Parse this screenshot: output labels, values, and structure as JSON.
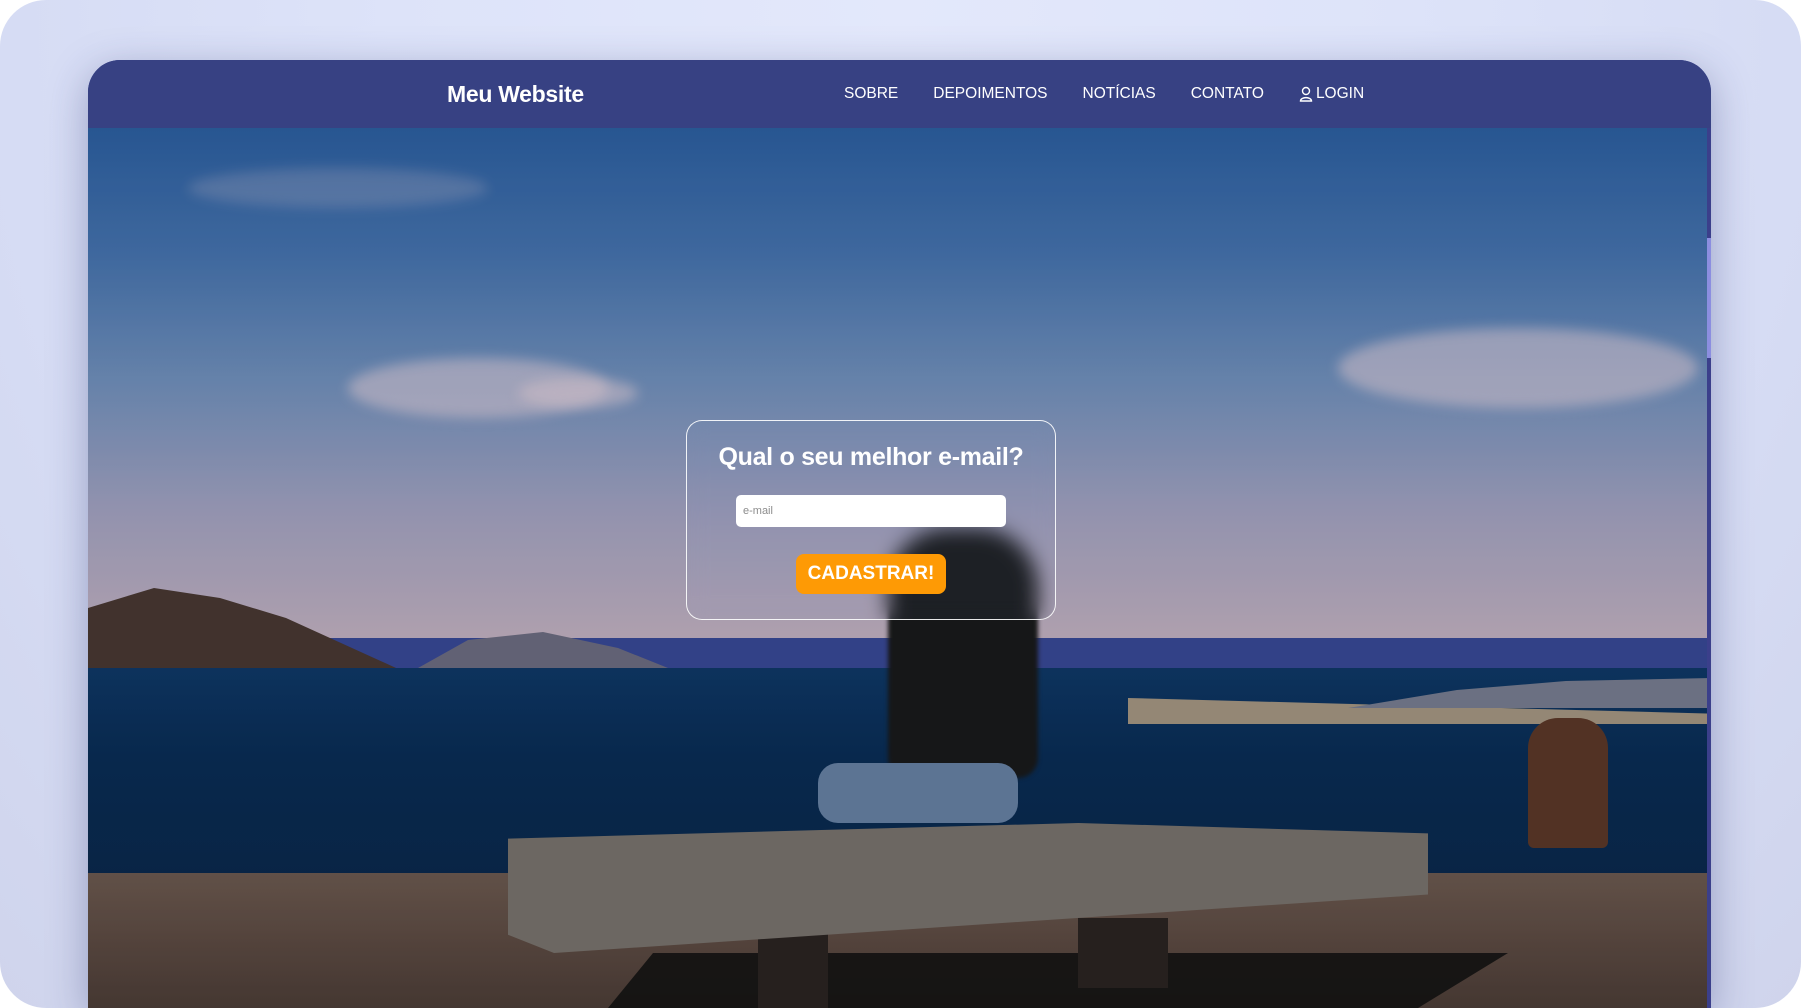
{
  "brand": "Meu Website",
  "nav": {
    "items": [
      {
        "label": "SOBRE"
      },
      {
        "label": "DEPOIMENTOS"
      },
      {
        "label": "NOTÍCIAS"
      },
      {
        "label": "CONTATO"
      },
      {
        "label": "LOGIN",
        "icon": "user-icon"
      }
    ]
  },
  "signup": {
    "title": "Qual o seu melhor e-mail?",
    "email_placeholder": "e-mail",
    "email_value": "",
    "button_label": "CADASTRAR!"
  },
  "colors": {
    "navbar": "#374183",
    "button": "#fe9a05",
    "frame": "#dde3f9"
  }
}
